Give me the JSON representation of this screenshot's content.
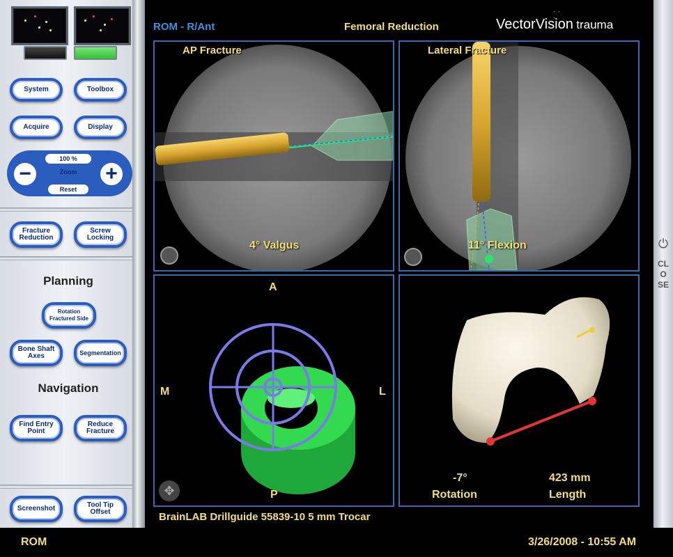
{
  "header": {
    "mode": "ROM - R/Ant",
    "step": "Femoral Reduction",
    "brand_main": "VectorVision",
    "brand_sub": "trauma"
  },
  "sidebar": {
    "system": "System",
    "toolbox": "Toolbox",
    "acquire": "Acquire",
    "display": "Display",
    "zoom_value": "100 %",
    "zoom_label": "Zoom",
    "reset": "Reset",
    "fracture_reduction": "Fracture\nReduction",
    "screw_locking": "Screw\nLocking",
    "planning": "Planning",
    "rotation_fractured_side": "Rotation\nFractured Side",
    "bone_shaft_axes": "Bone Shaft\nAxes",
    "segmentation": "Segmentation",
    "navigation": "Navigation",
    "find_entry_point": "Find Entry\nPoint",
    "reduce_fracture": "Reduce\nFracture",
    "screenshot": "Screenshot",
    "tool_tip_offset": "Tool Tip\nOffset"
  },
  "views": {
    "ap": {
      "label": "AP Fracture",
      "reading": "4° Valgus"
    },
    "lateral": {
      "label": "Lateral Fracture",
      "reading": "11° Flexion"
    },
    "axial": {
      "a": "A",
      "p": "P",
      "m": "M",
      "l": "L"
    },
    "model": {
      "rotation_value": "-7°",
      "rotation_label": "Rotation",
      "length_value": "423 mm",
      "length_label": "Length"
    }
  },
  "instrument": "BrainLAB Drillguide 55839-10 5 mm Trocar",
  "close_label": "CLOSE",
  "footer": {
    "mode": "ROM",
    "datetime": "3/26/2008 - 10:55 AM"
  },
  "colors": {
    "accent_blue": "#2a5dbe",
    "label_yellow": "#f2df7a",
    "header_blue": "#3f8fe0",
    "active_green": "#35c235"
  }
}
